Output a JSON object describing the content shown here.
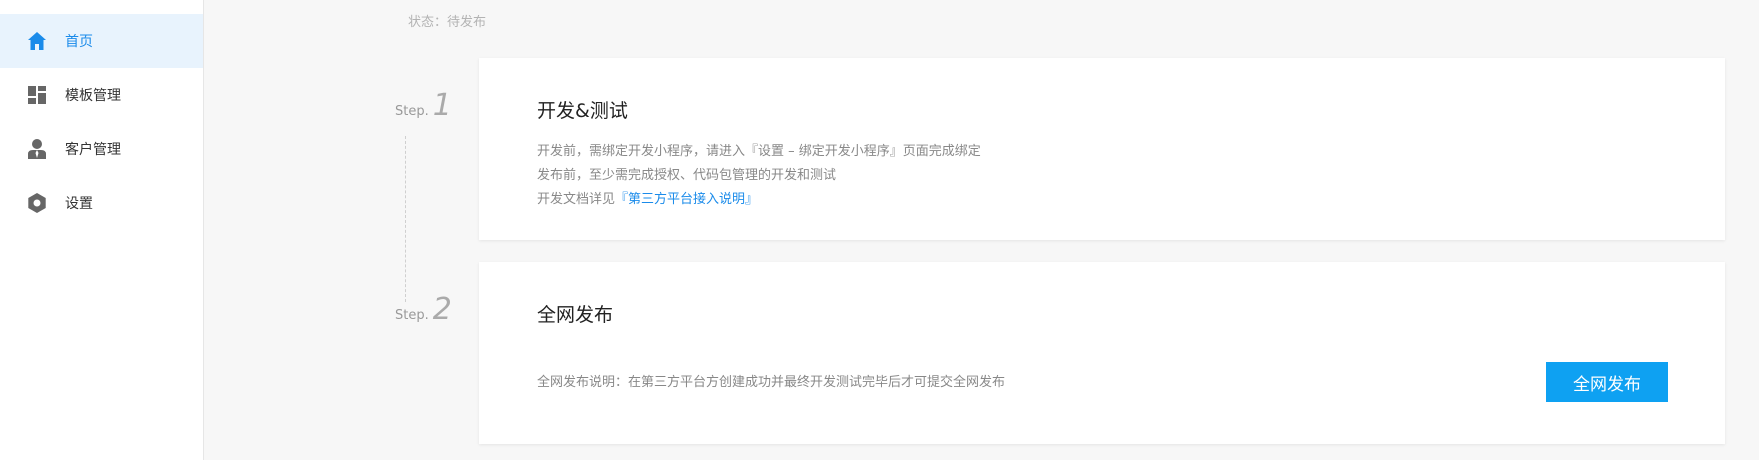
{
  "sidebar": {
    "items": [
      {
        "label": "首页",
        "icon": "home-icon",
        "active": true
      },
      {
        "label": "模板管理",
        "icon": "dashboard-icon",
        "active": false
      },
      {
        "label": "客户管理",
        "icon": "user-icon",
        "active": false
      },
      {
        "label": "设置",
        "icon": "gear-icon",
        "active": false
      }
    ]
  },
  "main": {
    "status": "状态：待发布",
    "steps": [
      {
        "step_prefix": "Step.",
        "step_number": "1",
        "title": "开发&测试",
        "lines": [
          "开发前，需绑定开发小程序，请进入『设置 – 绑定开发小程序』页面完成绑定",
          "发布前，至少需完成授权、代码包管理的开发和测试"
        ],
        "doc_prefix": "开发文档详见",
        "doc_link": "『第三方平台接入说明』"
      },
      {
        "step_prefix": "Step.",
        "step_number": "2",
        "title": "全网发布",
        "description": "全网发布说明：在第三方平台方创建成功并最终开发测试完毕后才可提交全网发布",
        "button_label": "全网发布"
      }
    ]
  },
  "colors": {
    "accent": "#1a8bea",
    "button": "#0ea1f2",
    "active_bg": "#e8f3fd"
  }
}
